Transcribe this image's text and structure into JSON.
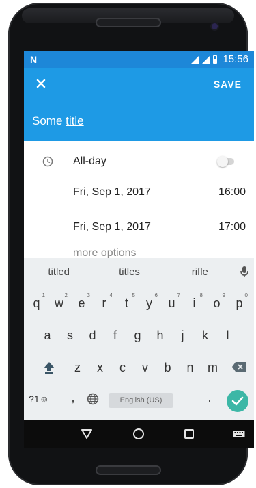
{
  "status_bar": {
    "notification_icon": "N",
    "time": "15:56",
    "icons": [
      "signal-icon",
      "signal-icon",
      "battery-icon"
    ]
  },
  "app_bar": {
    "close_icon": "close-icon",
    "save_label": "SAVE",
    "title_prefix": "Some ",
    "title_word": "title"
  },
  "event": {
    "all_day_label": "All-day",
    "all_day_enabled": false,
    "start_date": "Fri, Sep 1, 2017",
    "start_time": "16:00",
    "end_date": "Fri, Sep 1, 2017",
    "end_time": "17:00",
    "more_options": "more options"
  },
  "keyboard": {
    "suggestions": [
      "titled",
      "titles",
      "rifle"
    ],
    "row1": [
      {
        "key": "q",
        "hint": "1"
      },
      {
        "key": "w",
        "hint": "2"
      },
      {
        "key": "e",
        "hint": "3"
      },
      {
        "key": "r",
        "hint": "4"
      },
      {
        "key": "t",
        "hint": "5"
      },
      {
        "key": "y",
        "hint": "6"
      },
      {
        "key": "u",
        "hint": "7"
      },
      {
        "key": "i",
        "hint": "8"
      },
      {
        "key": "o",
        "hint": "9"
      },
      {
        "key": "p",
        "hint": "0"
      }
    ],
    "row2": [
      "a",
      "s",
      "d",
      "f",
      "g",
      "h",
      "j",
      "k",
      "l"
    ],
    "row3": [
      "z",
      "x",
      "c",
      "v",
      "b",
      "n",
      "m"
    ],
    "symbols_key": "?1☺",
    "comma_key": ",",
    "period_key": ".",
    "space_label": "English (US)"
  },
  "nav_bar": {
    "back_icon": "back-icon",
    "home_icon": "home-icon",
    "recents_icon": "recents-icon",
    "keyboard_switch_icon": "keyboard-icon"
  },
  "colors": {
    "status_bar": "#1d87d8",
    "app_bar": "#1e9ae5",
    "enter_key": "#3cb7a6"
  }
}
